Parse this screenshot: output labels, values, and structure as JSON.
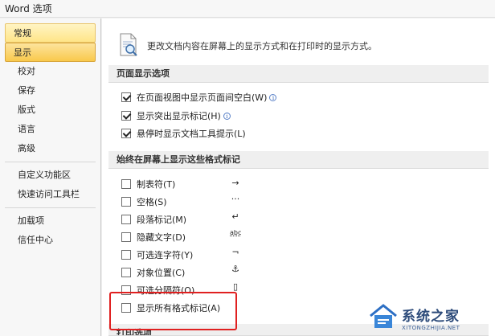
{
  "window": {
    "title": "Word 选项"
  },
  "sidebar": {
    "items": [
      {
        "label": "常规",
        "state": "hover"
      },
      {
        "label": "显示",
        "state": "selected"
      },
      {
        "label": "校对"
      },
      {
        "label": "保存"
      },
      {
        "label": "版式"
      },
      {
        "label": "语言"
      },
      {
        "label": "高级"
      },
      {
        "label": "自定义功能区"
      },
      {
        "label": "快速访问工具栏"
      },
      {
        "label": "加载项"
      },
      {
        "label": "信任中心"
      }
    ]
  },
  "main": {
    "intro_text": "更改文档内容在屏幕上的显示方式和在打印时的显示方式。",
    "section_page": {
      "title": "页面显示选项",
      "options": [
        {
          "label": "在页面视图中显示页面间空白(W)",
          "checked": true,
          "info": true
        },
        {
          "label": "显示突出显示标记(H)",
          "checked": true,
          "info": true
        },
        {
          "label": "悬停时显示文档工具提示(L)",
          "checked": true,
          "info": false
        }
      ]
    },
    "section_marks": {
      "title": "始终在屏幕上显示这些格式标记",
      "options": [
        {
          "label": "制表符(T)",
          "checked": false,
          "symbol": "→"
        },
        {
          "label": "空格(S)",
          "checked": false,
          "symbol": "···"
        },
        {
          "label": "段落标记(M)",
          "checked": false,
          "symbol": "↵"
        },
        {
          "label": "隐藏文字(D)",
          "checked": false,
          "symbol": "abc"
        },
        {
          "label": "可选连字符(Y)",
          "checked": false,
          "symbol": "¬"
        },
        {
          "label": "对象位置(C)",
          "checked": false,
          "symbol": "⚓"
        },
        {
          "label": "可选分隔符(O)",
          "checked": false,
          "symbol": "▯"
        },
        {
          "label": "显示所有格式标记(A)",
          "checked": false,
          "symbol": ""
        }
      ]
    },
    "section_print": {
      "title": "打印选项"
    }
  },
  "watermark": {
    "cn": "系统之家",
    "en": "XITONGZHIJIA.NET"
  },
  "colors": {
    "highlight_box": "#e02020",
    "selected_item": "#f9c94c"
  }
}
